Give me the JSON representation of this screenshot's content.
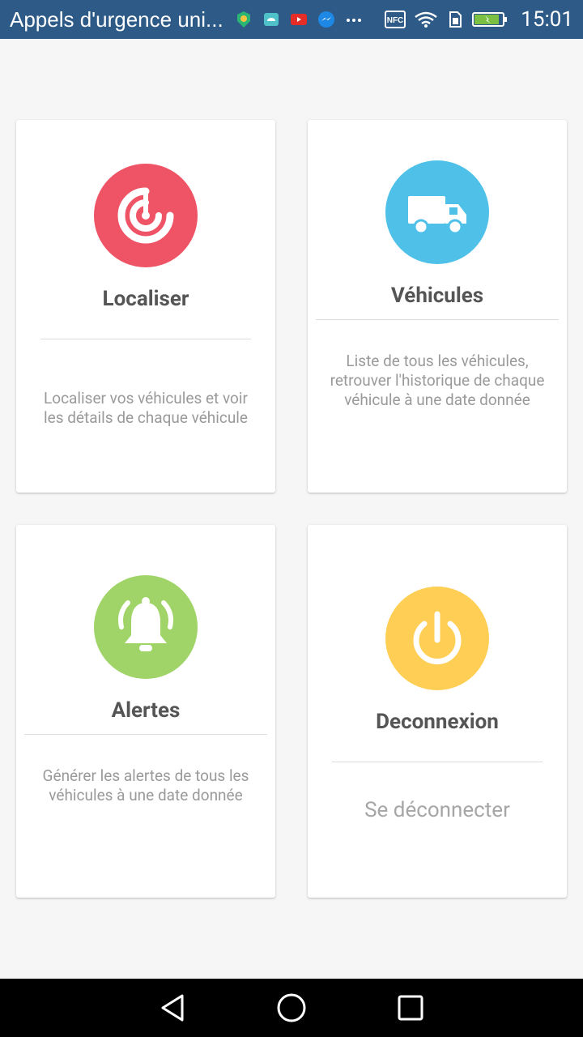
{
  "status_bar": {
    "title": "Appels d'urgence uni...",
    "time": "15:01",
    "icons": [
      "shield-app-icon",
      "android-icon",
      "youtube-icon",
      "messenger-icon",
      "more-icon",
      "nfc-icon",
      "wifi-icon",
      "sim-icon",
      "battery-charging-icon"
    ]
  },
  "cards": {
    "localiser": {
      "title": "Localiser",
      "description": "Localiser vos véhicules et voir les détails de chaque véhicule",
      "icon": "radar-icon",
      "color": "#ef5466"
    },
    "vehicules": {
      "title": "Véhicules",
      "description": "Liste de tous les véhicules, retrouver l'historique de chaque véhicule à une date donnée",
      "icon": "truck-icon",
      "color": "#4fc1e9"
    },
    "alertes": {
      "title": "Alertes",
      "description": "Générer les alertes de tous les véhicules à une date donnée",
      "icon": "bell-icon",
      "color": "#a0d468"
    },
    "deconnexion": {
      "title": "Deconnexion",
      "description": "Se déconnecter",
      "icon": "power-icon",
      "color": "#ffce54"
    }
  },
  "nav_bar": {
    "buttons": [
      "back-icon",
      "home-icon",
      "recents-icon"
    ]
  }
}
